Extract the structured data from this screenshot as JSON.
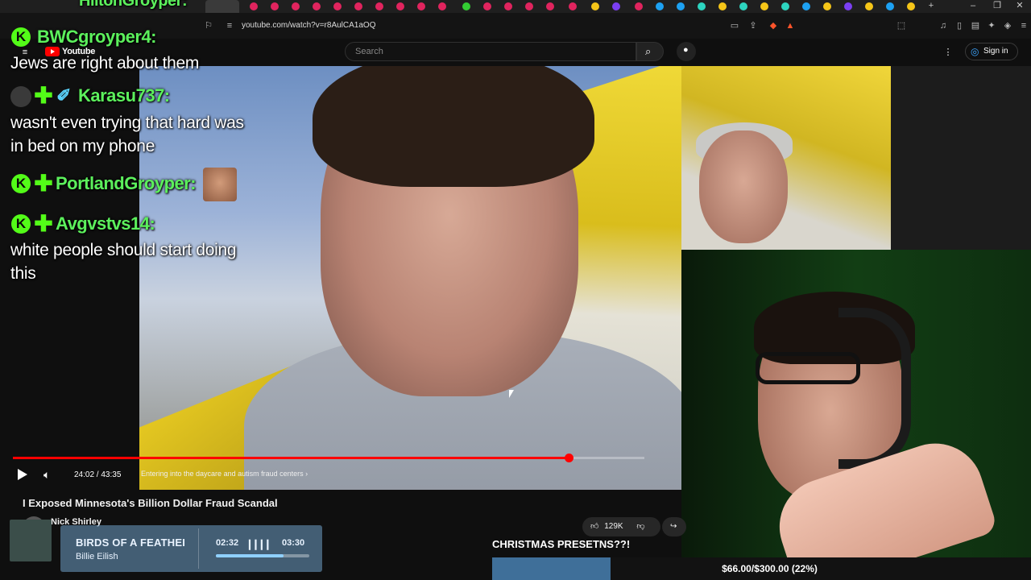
{
  "browser": {
    "url": "youtube.com/watch?v=r8AulCA1aOQ",
    "tab_title": "HiltonGroyper:"
  },
  "youtube": {
    "logo": "Youtube",
    "search_placeholder": "Search",
    "sign_in": "Sign in"
  },
  "chat": [
    {
      "user": "BWCgroyper4:",
      "message": [
        "Jews are right about them"
      ]
    },
    {
      "user": "Karasu737:",
      "message": [
        "wasn't even trying that hard was",
        "in bed on my phone"
      ]
    },
    {
      "user": "PortlandGroyper:",
      "message": []
    },
    {
      "user": "Avgvstvs14:",
      "message": [
        "white people should start doing",
        "this"
      ]
    }
  ],
  "player": {
    "time": "24:02 / 43:35",
    "chapter": "Entering into the daycare and autism fraud centers",
    "progress_fraction": 0.88
  },
  "video": {
    "title": "I Exposed Minnesota's Billion Dollar Fraud Scandal",
    "channel": "Nick Shirley",
    "likes": "129K"
  },
  "music": {
    "title": "BIRDS OF A FEATHEI",
    "artist": "Billie Eilish",
    "elapsed": "02:32",
    "duration": "03:30",
    "progress_fraction": 0.72
  },
  "goal": {
    "title": "CHRISTMAS PRESETNS??!",
    "text": "$66.00/$300.00 (22%)",
    "progress_fraction": 0.22
  },
  "colors": {
    "chat_user": "#5cf05c",
    "badge": "#53fc18",
    "progress": "#ff0000",
    "goal_fill": "#3f6f99"
  }
}
